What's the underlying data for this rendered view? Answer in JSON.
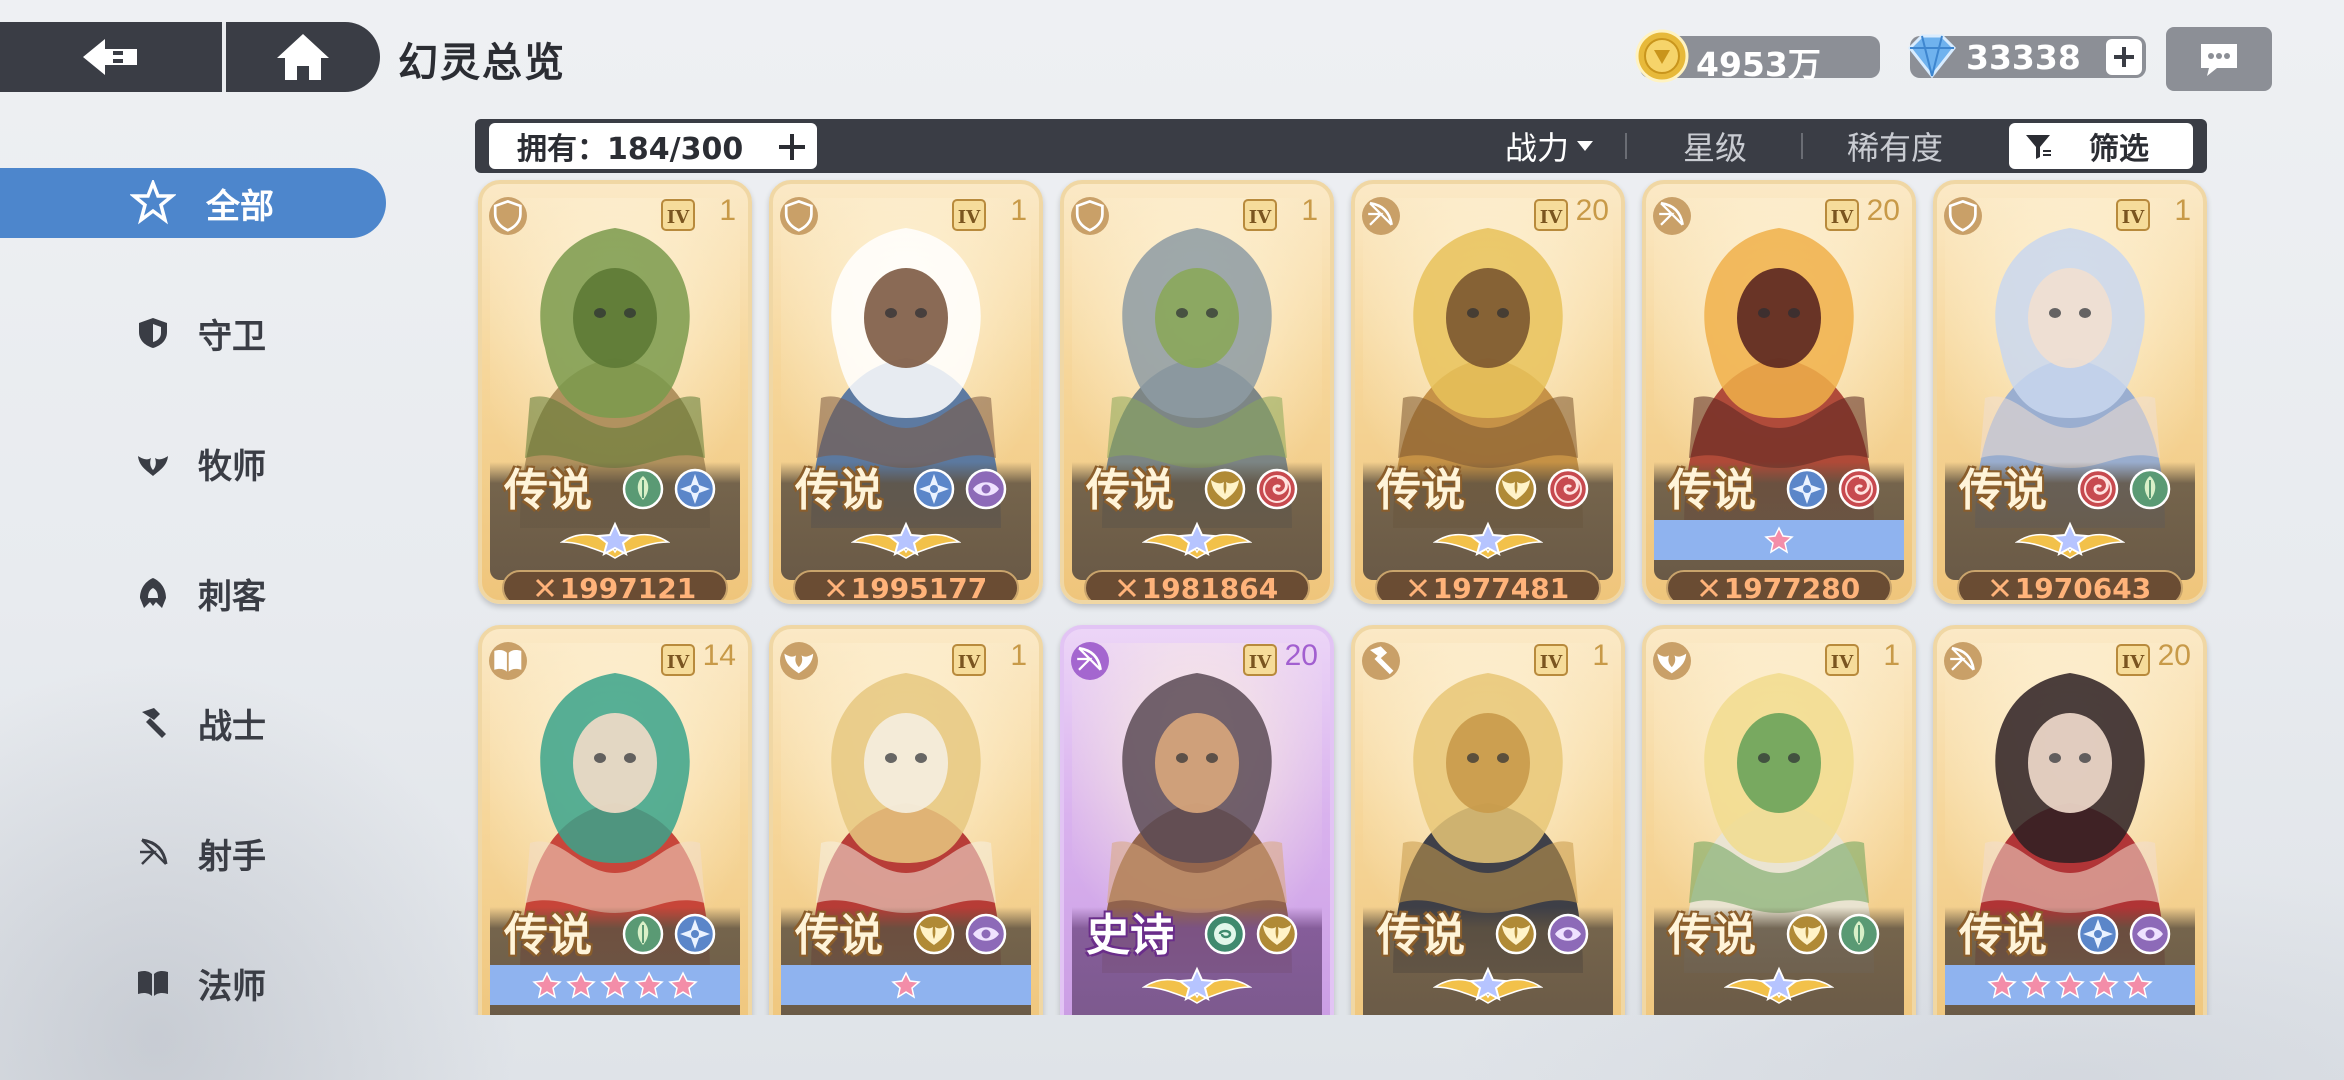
{
  "header": {
    "title": "幻灵总览",
    "gold": "4953万",
    "gems": "33338"
  },
  "filter_bar": {
    "owned_label": "拥有：184/300",
    "sort_power": "战力",
    "sort_star": "星级",
    "sort_rarity": "稀有度",
    "filter": "筛选"
  },
  "sidebar": {
    "items": [
      {
        "label": "全部",
        "icon": "all-star-icon"
      },
      {
        "label": "守卫",
        "icon": "shield-icon"
      },
      {
        "label": "牧师",
        "icon": "priest-wing-icon"
      },
      {
        "label": "刺客",
        "icon": "assassin-hood-icon"
      },
      {
        "label": "战士",
        "icon": "hammer-icon"
      },
      {
        "label": "射手",
        "icon": "bow-icon"
      },
      {
        "label": "法师",
        "icon": "book-icon"
      }
    ]
  },
  "cards": [
    {
      "level": "1",
      "rarity": "传说",
      "power": "1997121",
      "class_icon": "shield-icon",
      "elements": [
        "nature-leaf-icon",
        "frost-star-icon"
      ],
      "stars": 0,
      "palette": [
        "#7a9a4c",
        "#a88a56",
        "#5d7a35"
      ]
    },
    {
      "level": "1",
      "rarity": "传说",
      "power": "1995177",
      "class_icon": "shield-icon",
      "elements": [
        "frost-star-icon",
        "arcane-eye-icon"
      ],
      "stars": 0,
      "palette": [
        "#ffffff",
        "#4b6fa0",
        "#7d5a42"
      ]
    },
    {
      "level": "1",
      "rarity": "传说",
      "power": "1981864",
      "class_icon": "shield-icon",
      "elements": [
        "light-wing-icon",
        "fire-swirl-icon"
      ],
      "stars": 0,
      "palette": [
        "#8d9ba3",
        "#6f7c82",
        "#8aa75a"
      ]
    },
    {
      "level": "20",
      "rarity": "传说",
      "power": "1977481",
      "class_icon": "bow-icon",
      "elements": [
        "light-wing-icon",
        "fire-swirl-icon"
      ],
      "stars": 0,
      "palette": [
        "#e7c25a",
        "#c08a3c",
        "#7b5630"
      ]
    },
    {
      "level": "20",
      "rarity": "传说",
      "power": "1977280",
      "class_icon": "bow-icon",
      "elements": [
        "frost-star-icon",
        "fire-swirl-icon"
      ],
      "stars": 1,
      "palette": [
        "#f0b04a",
        "#a73b2d",
        "#5a2620"
      ]
    },
    {
      "level": "1",
      "rarity": "传说",
      "power": "1970643",
      "class_icon": "shield-icon",
      "elements": [
        "fire-swirl-icon",
        "nature-leaf-icon"
      ],
      "stars": 0,
      "palette": [
        "#c9d7ef",
        "#8fa8d4",
        "#f1dfd0"
      ]
    },
    {
      "level": "14",
      "rarity": "传说",
      "power": "",
      "class_icon": "book-icon",
      "elements": [
        "nature-leaf-icon",
        "frost-star-icon"
      ],
      "stars": 5,
      "palette": [
        "#3aa38b",
        "#c2352f",
        "#f3dcc8"
      ]
    },
    {
      "level": "1",
      "rarity": "传说",
      "power": "",
      "class_icon": "priest-wing-icon",
      "elements": [
        "light-wing-icon",
        "arcane-eye-icon"
      ],
      "stars": 1,
      "palette": [
        "#e6c880",
        "#b02b2b",
        "#f5eee0"
      ]
    },
    {
      "level": "20",
      "rarity": "史诗",
      "power": "",
      "class_icon": "bow-icon",
      "elements": [
        "spiral-green-icon",
        "light-wing-icon"
      ],
      "stars": 0,
      "palette": [
        "#5a4a55",
        "#8a5a3c",
        "#d9a77c"
      ]
    },
    {
      "level": "1",
      "rarity": "传说",
      "power": "",
      "class_icon": "hammer-icon",
      "elements": [
        "light-wing-icon",
        "arcane-eye-icon"
      ],
      "stars": 0,
      "palette": [
        "#e8c777",
        "#2a2f3e",
        "#c99a4a"
      ]
    },
    {
      "level": "1",
      "rarity": "传说",
      "power": "",
      "class_icon": "priest-wing-icon",
      "elements": [
        "light-wing-icon",
        "nature-leaf-icon"
      ],
      "stars": 0,
      "palette": [
        "#f1dc8e",
        "#e8e4d6",
        "#6aa35a"
      ]
    },
    {
      "level": "20",
      "rarity": "传说",
      "power": "",
      "class_icon": "bow-icon",
      "elements": [
        "frost-star-icon",
        "arcane-eye-icon"
      ],
      "stars": 5,
      "palette": [
        "#2b1f22",
        "#a8222a",
        "#f2dccd"
      ]
    }
  ],
  "colors": {
    "accent": "#4d86cc",
    "bar": "#3a3d45",
    "power_text": "#ffb37a"
  }
}
